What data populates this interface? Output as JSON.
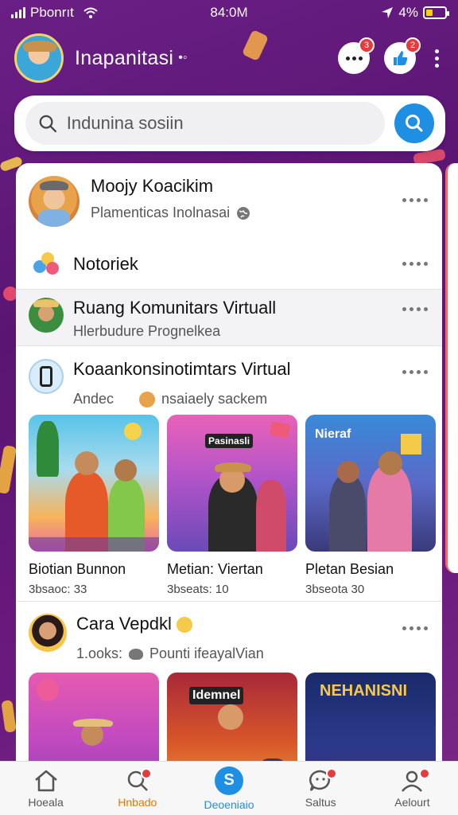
{
  "status_bar": {
    "carrier": "Pbonrıt",
    "time": "84:0M",
    "battery": "4%"
  },
  "header": {
    "title": "Inapanitasi",
    "title_glyph": "•◦",
    "messages_badge": "3",
    "notifications_badge": "2"
  },
  "search": {
    "placeholder": "Indunina sosiin"
  },
  "feed": {
    "items": [
      {
        "title": "Moojy Koacikim",
        "subtitle": "Plamenticas Inolnasai"
      },
      {
        "title": "Notoriek"
      },
      {
        "title": "Ruang Komunitars Virtuall",
        "subtitle": "Hlerbudure Prognelkea"
      },
      {
        "title": "Koaankonsinotimtars Virtual",
        "subtitle_prefix": "Andec",
        "subtitle": "nsaiaely sackem",
        "thumbs": [
          {
            "title": "Biotian Bunnon",
            "sub": "3bsaoc: 33",
            "sign": ""
          },
          {
            "title": "Metian: Viertan",
            "sub": "3bseats: 10",
            "sign": "Pasinasli"
          },
          {
            "title": "Pletan Besian",
            "sub": "3bseota 30",
            "sign": "Nieraf"
          }
        ]
      },
      {
        "title": "Cara Vepdkl",
        "subtitle_prefix": "1.ooks:",
        "subtitle": "Pounti ifeayalVian",
        "thumbs": [
          {
            "sign": ""
          },
          {
            "sign": "Idemnel"
          },
          {
            "sign": "NEHANISNI"
          }
        ]
      }
    ]
  },
  "bottom_nav": {
    "items": [
      {
        "label": "Hoeala",
        "color": "#555555"
      },
      {
        "label": "Hnbado",
        "color": "#e2780c"
      },
      {
        "label": "Deoeniaio",
        "color": "#1f8fe4"
      },
      {
        "label": "Saltus",
        "color": "#555555"
      },
      {
        "label": "Aelourt",
        "color": "#555555"
      }
    ]
  },
  "colors": {
    "accent": "#1f8fe4",
    "background": "#5a1572",
    "badge": "#e63b3b"
  }
}
